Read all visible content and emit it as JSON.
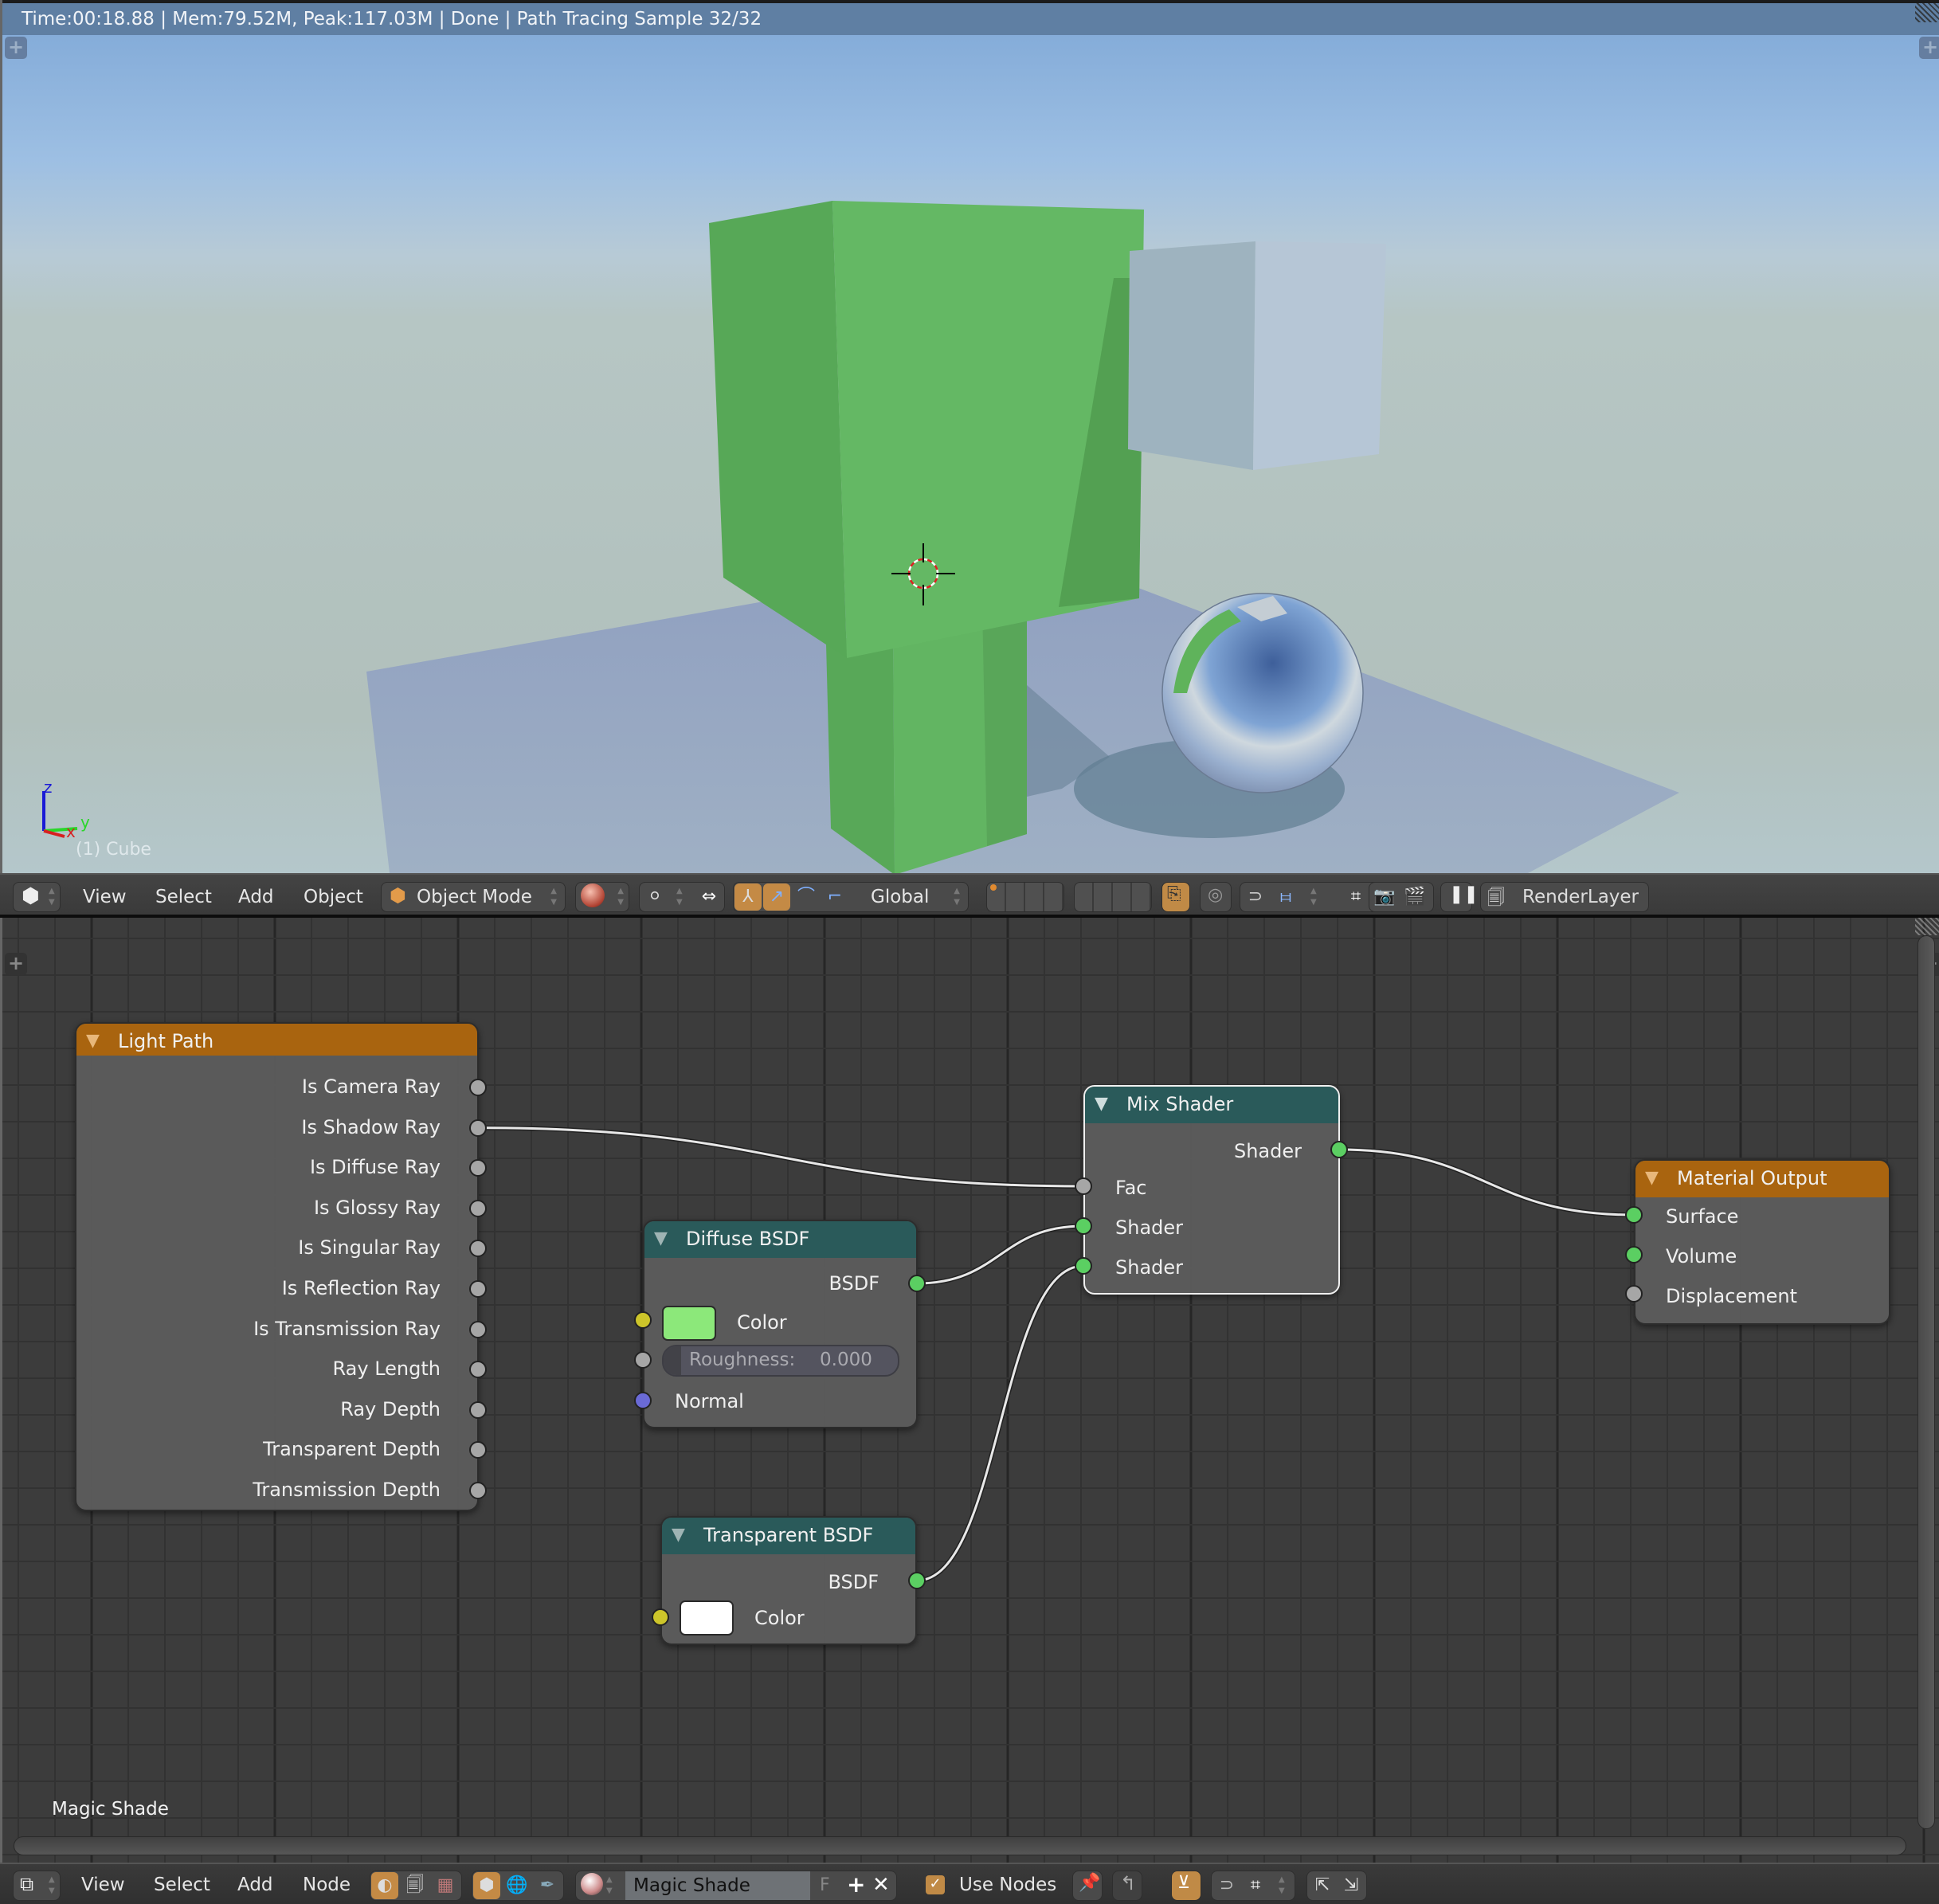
{
  "status_bar": {
    "text": "Time:00:18.88 | Mem:79.52M, Peak:117.03M | Done | Path Tracing Sample 32/32"
  },
  "viewport": {
    "active_object_label": "(1) Cube",
    "axes": {
      "x": "x",
      "y": "y",
      "z": "z"
    },
    "colors": {
      "green_object": "#63b762",
      "gray_cube": "#a9bac5",
      "floor": "#96a6c2",
      "sky_top": "#7ea7d6"
    }
  },
  "view3d_header": {
    "editor_type_icon": "cube-editor-icon",
    "menus": [
      "View",
      "Select",
      "Add",
      "Object"
    ],
    "mode": "Object Mode",
    "transform_orientation": "Global",
    "render_layer": "RenderLayer"
  },
  "node_editor": {
    "material_name_overlay": "Magic Shade",
    "nodes": {
      "light_path": {
        "title": "Light Path",
        "outputs": [
          "Is Camera Ray",
          "Is Shadow Ray",
          "Is Diffuse Ray",
          "Is Glossy Ray",
          "Is Singular Ray",
          "Is Reflection Ray",
          "Is Transmission Ray",
          "Ray Length",
          "Ray Depth",
          "Transparent Depth",
          "Transmission Depth"
        ]
      },
      "diffuse_bsdf": {
        "title": "Diffuse BSDF",
        "output": "BSDF",
        "color_label": "Color",
        "color_value": "#8ce87a",
        "roughness_label": "Roughness:",
        "roughness_value": "0.000",
        "normal_label": "Normal"
      },
      "transparent_bsdf": {
        "title": "Transparent BSDF",
        "output": "BSDF",
        "color_label": "Color",
        "color_value": "#ffffff"
      },
      "mix_shader": {
        "title": "Mix Shader",
        "output": "Shader",
        "inputs": [
          "Fac",
          "Shader",
          "Shader"
        ]
      },
      "material_output": {
        "title": "Material Output",
        "inputs": [
          "Surface",
          "Volume",
          "Displacement"
        ]
      }
    },
    "links": [
      {
        "from": "light_path.Is Shadow Ray",
        "to": "mix_shader.Fac"
      },
      {
        "from": "diffuse_bsdf.BSDF",
        "to": "mix_shader.Shader 1"
      },
      {
        "from": "transparent_bsdf.BSDF",
        "to": "mix_shader.Shader 2"
      },
      {
        "from": "mix_shader.Shader",
        "to": "material_output.Surface"
      }
    ]
  },
  "node_header": {
    "editor_type_icon": "node-editor-icon",
    "menus": [
      "View",
      "Select",
      "Add",
      "Node"
    ],
    "material_name": "Magic Shade",
    "fake_user_label": "F",
    "use_nodes_label": "Use Nodes",
    "use_nodes_checked": true
  }
}
